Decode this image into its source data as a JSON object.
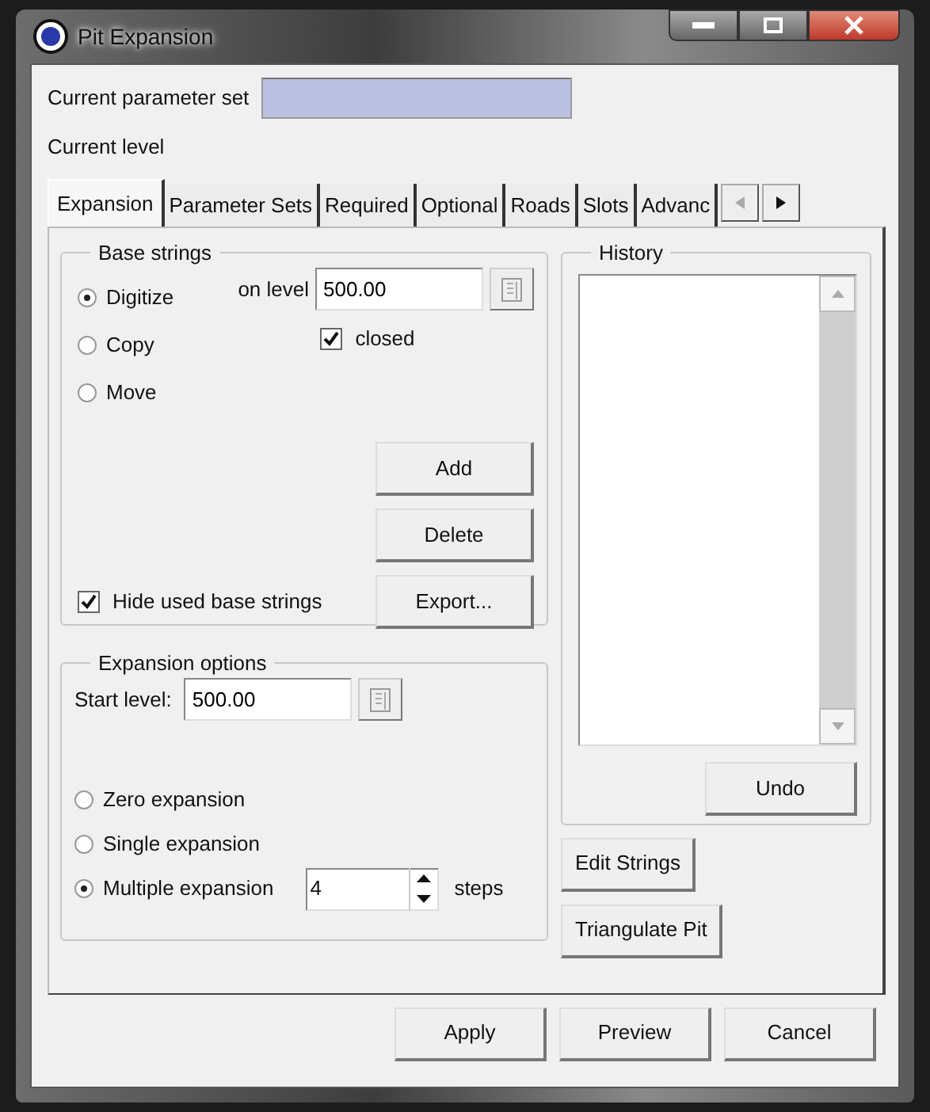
{
  "window": {
    "title": "Pit Expansion"
  },
  "header": {
    "parameter_set_label": "Current parameter set",
    "current_level_label": "Current level"
  },
  "tabs": [
    {
      "label": "Expansion",
      "selected": true
    },
    {
      "label": "Parameter Sets",
      "selected": false
    },
    {
      "label": "Required",
      "selected": false
    },
    {
      "label": "Optional",
      "selected": false
    },
    {
      "label": "Roads",
      "selected": false
    },
    {
      "label": "Slots",
      "selected": false
    },
    {
      "label": "Advanc",
      "selected": false
    }
  ],
  "base_strings": {
    "title": "Base strings",
    "modes": [
      {
        "label": "Digitize",
        "selected": true
      },
      {
        "label": "Copy",
        "selected": false
      },
      {
        "label": "Move",
        "selected": false
      }
    ],
    "level_label": "on level",
    "level_value": "500.00",
    "closed": {
      "label": "closed",
      "checked": true
    },
    "buttons": [
      "Add",
      "Delete",
      "Export..."
    ],
    "hide_used": {
      "label": "Hide used base strings",
      "checked": true
    }
  },
  "expansion_options": {
    "title": "Expansion options",
    "start_level_label": "Start level:",
    "start_level_value": "500.00",
    "modes": [
      {
        "label": "Zero expansion",
        "selected": false
      },
      {
        "label": "Single expansion",
        "selected": false
      },
      {
        "label": "Multiple expansion",
        "selected": true
      }
    ],
    "steps_value": "4",
    "steps_label": "steps"
  },
  "history": {
    "title": "History",
    "button": "Undo"
  },
  "side_buttons": [
    "Edit Strings",
    "Triangulate Pit"
  ],
  "footer_buttons": [
    "Apply",
    "Preview",
    "Cancel"
  ]
}
